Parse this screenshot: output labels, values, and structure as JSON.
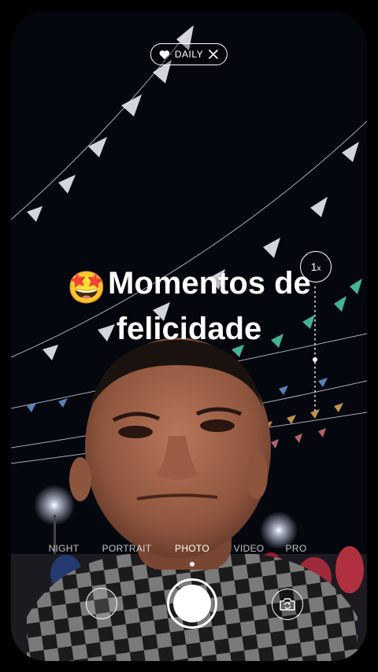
{
  "header": {
    "daily_label": "DAILY"
  },
  "caption": {
    "emoji": "🤩",
    "text_line1": "Momentos de",
    "text_line2": "felicidade"
  },
  "zoom": {
    "label": "1",
    "suffix": "x"
  },
  "modes": [
    {
      "label": "NIGHT"
    },
    {
      "label": "PORTRAIT"
    },
    {
      "label": "PHOTO"
    },
    {
      "label": "VIDEO"
    },
    {
      "label": "PRO"
    }
  ],
  "active_mode": "PHOTO",
  "icons": {
    "heart": "heart-icon",
    "close": "close-icon",
    "camera_flip": "camera-flip-icon"
  },
  "colors": {
    "accent": "#ffffff"
  }
}
